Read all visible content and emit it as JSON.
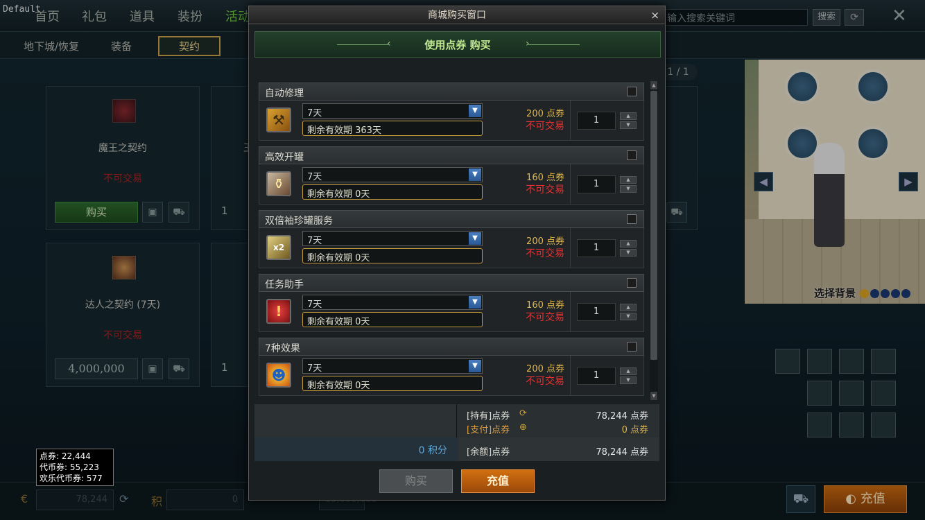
{
  "default_tag": "Default",
  "nav": {
    "tabs": [
      "首页",
      "礼包",
      "道具",
      "装扮",
      "活动"
    ],
    "search_placeholder": "输入搜索关键词",
    "search_button": "搜索"
  },
  "subnav": {
    "tabs": [
      "地下城/恢复",
      "装备",
      "契约"
    ],
    "active": "契约"
  },
  "page_indicator": "1 / 1",
  "cards": [
    {
      "name": "魔王之契约",
      "trade": "不可交易",
      "buy_label": "购买"
    },
    {
      "name": "达人之契约 (7天)",
      "trade": "不可交易",
      "price": "4,000,000"
    }
  ],
  "partial_cards": {
    "name_fragment": "王",
    "price_fragment_1": "1",
    "price_fragment_2": "1"
  },
  "preview": {
    "bg_label": "选择背景"
  },
  "bottom": {
    "field1": "78,244",
    "field2": "0",
    "field3": "15,000,000",
    "charge_label": "充值"
  },
  "balance_tip": {
    "line1": "点券: 22,444",
    "line2": "代币券: 55,223",
    "line3": "欢乐代币券: 577"
  },
  "modal": {
    "title": "商城购买窗口",
    "close": "×",
    "pay_mode": "使用点券 购买",
    "items": [
      {
        "name": "自动修理",
        "period": "7天",
        "remain": "剩余有效期 363天",
        "price": "200 点券",
        "trade": "不可交易",
        "qty": "1",
        "icon": "hammer-icon"
      },
      {
        "name": "高效开罐",
        "period": "7天",
        "remain": "剩余有效期 0天",
        "price": "160 点券",
        "trade": "不可交易",
        "qty": "1",
        "icon": "jar-icon"
      },
      {
        "name": "双倍袖珍罐服务",
        "period": "7天",
        "remain": "剩余有效期 0天",
        "price": "200 点券",
        "trade": "不可交易",
        "qty": "1",
        "icon": "double-jar-icon"
      },
      {
        "name": "任务助手",
        "period": "7天",
        "remain": "剩余有效期 0天",
        "price": "160 点券",
        "trade": "不可交易",
        "qty": "1",
        "icon": "alert-icon"
      },
      {
        "name": "7种效果",
        "period": "7天",
        "remain": "剩余有效期 0天",
        "price": "200 点券",
        "trade": "不可交易",
        "qty": "1",
        "icon": "person-icon"
      }
    ],
    "summary": {
      "points": "0 积分",
      "owned_label": "[持有]点券",
      "owned_value": "78,244 点券",
      "pay_label": "[支付]点券",
      "pay_value": "0 点券",
      "balance_label": "[余额]点券",
      "balance_value": "78,244 点券"
    },
    "buy_button": "购买",
    "charge_button": "充值"
  },
  "colors": {
    "accent_green": "#6fc53d",
    "untradeable_red": "#e83030",
    "price_gold": "#e0b850",
    "charge_orange": "#d27010"
  }
}
